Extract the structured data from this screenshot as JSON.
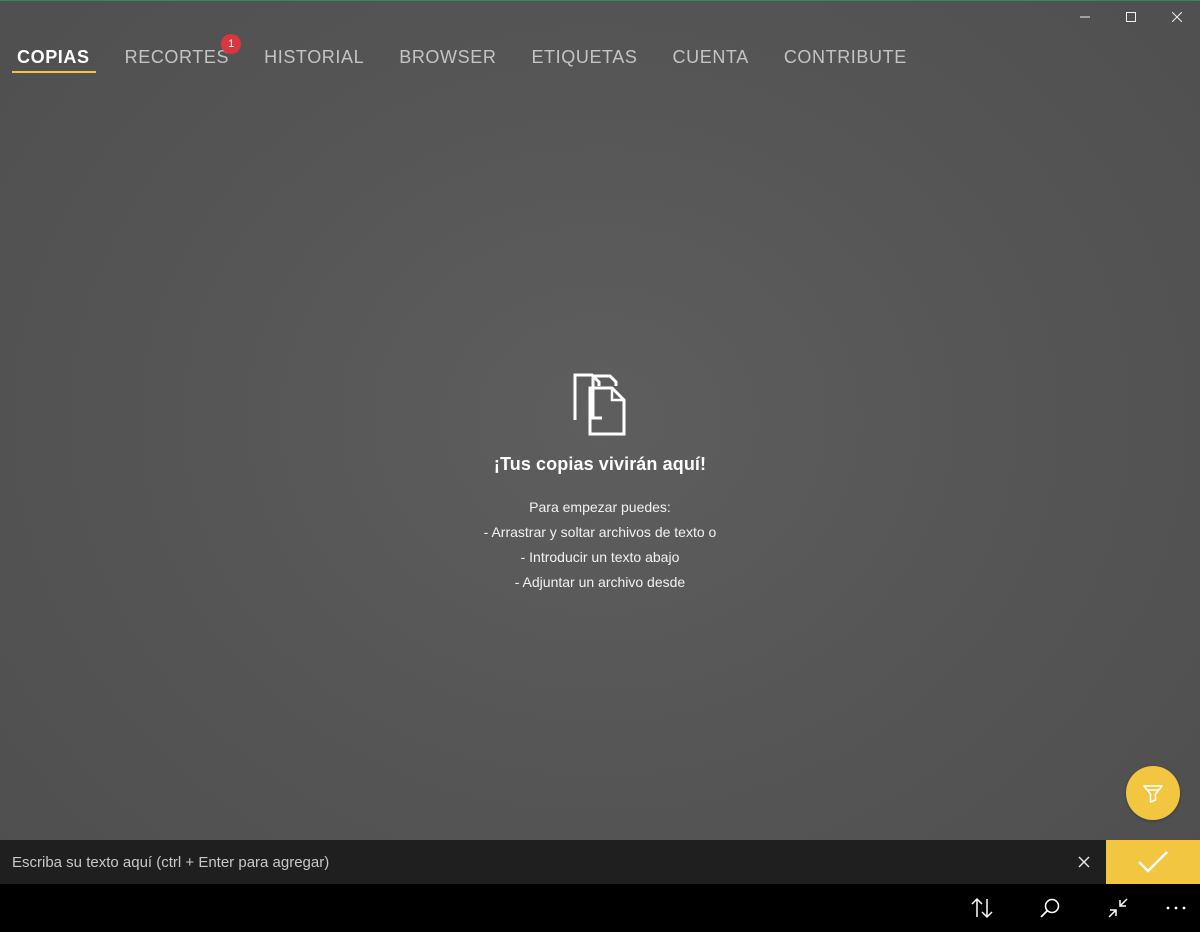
{
  "window": {
    "accent_color": "#2f8f4f",
    "controls": [
      {
        "name": "minimize-icon"
      },
      {
        "name": "maximize-icon"
      },
      {
        "name": "close-icon"
      }
    ]
  },
  "tabs": [
    {
      "label": "COPIAS",
      "active": true
    },
    {
      "label": "RECORTES",
      "badge": "1"
    },
    {
      "label": "HISTORIAL"
    },
    {
      "label": "BROWSER"
    },
    {
      "label": "ETIQUETAS"
    },
    {
      "label": "CUENTA"
    },
    {
      "label": "CONTRIBUTE"
    }
  ],
  "empty_state": {
    "icon": "copy-documents-icon",
    "title": "¡Tus copias vivirán aquí!",
    "lines": [
      "Para empezar puedes:",
      "- Arrastrar y soltar archivos de texto o",
      "- Introducir un texto abajo",
      "- Adjuntar un archivo desde"
    ]
  },
  "fab": {
    "icon": "filter-icon",
    "color": "#f2c640"
  },
  "input_bar": {
    "placeholder": "Escriba su texto aquí (ctrl + Enter para agregar)",
    "value": "",
    "clear_icon": "close-icon",
    "submit_icon": "checkmark-icon",
    "submit_color": "#f2c640"
  },
  "command_bar": {
    "buttons": [
      "sort-icon",
      "search-icon",
      "collapse-icon",
      "more-icon"
    ]
  },
  "colors": {
    "accent": "#f2c640",
    "badge": "#d9363e",
    "background": "#555555",
    "input_bar": "#1f1f1f",
    "command_bar": "#000000"
  }
}
